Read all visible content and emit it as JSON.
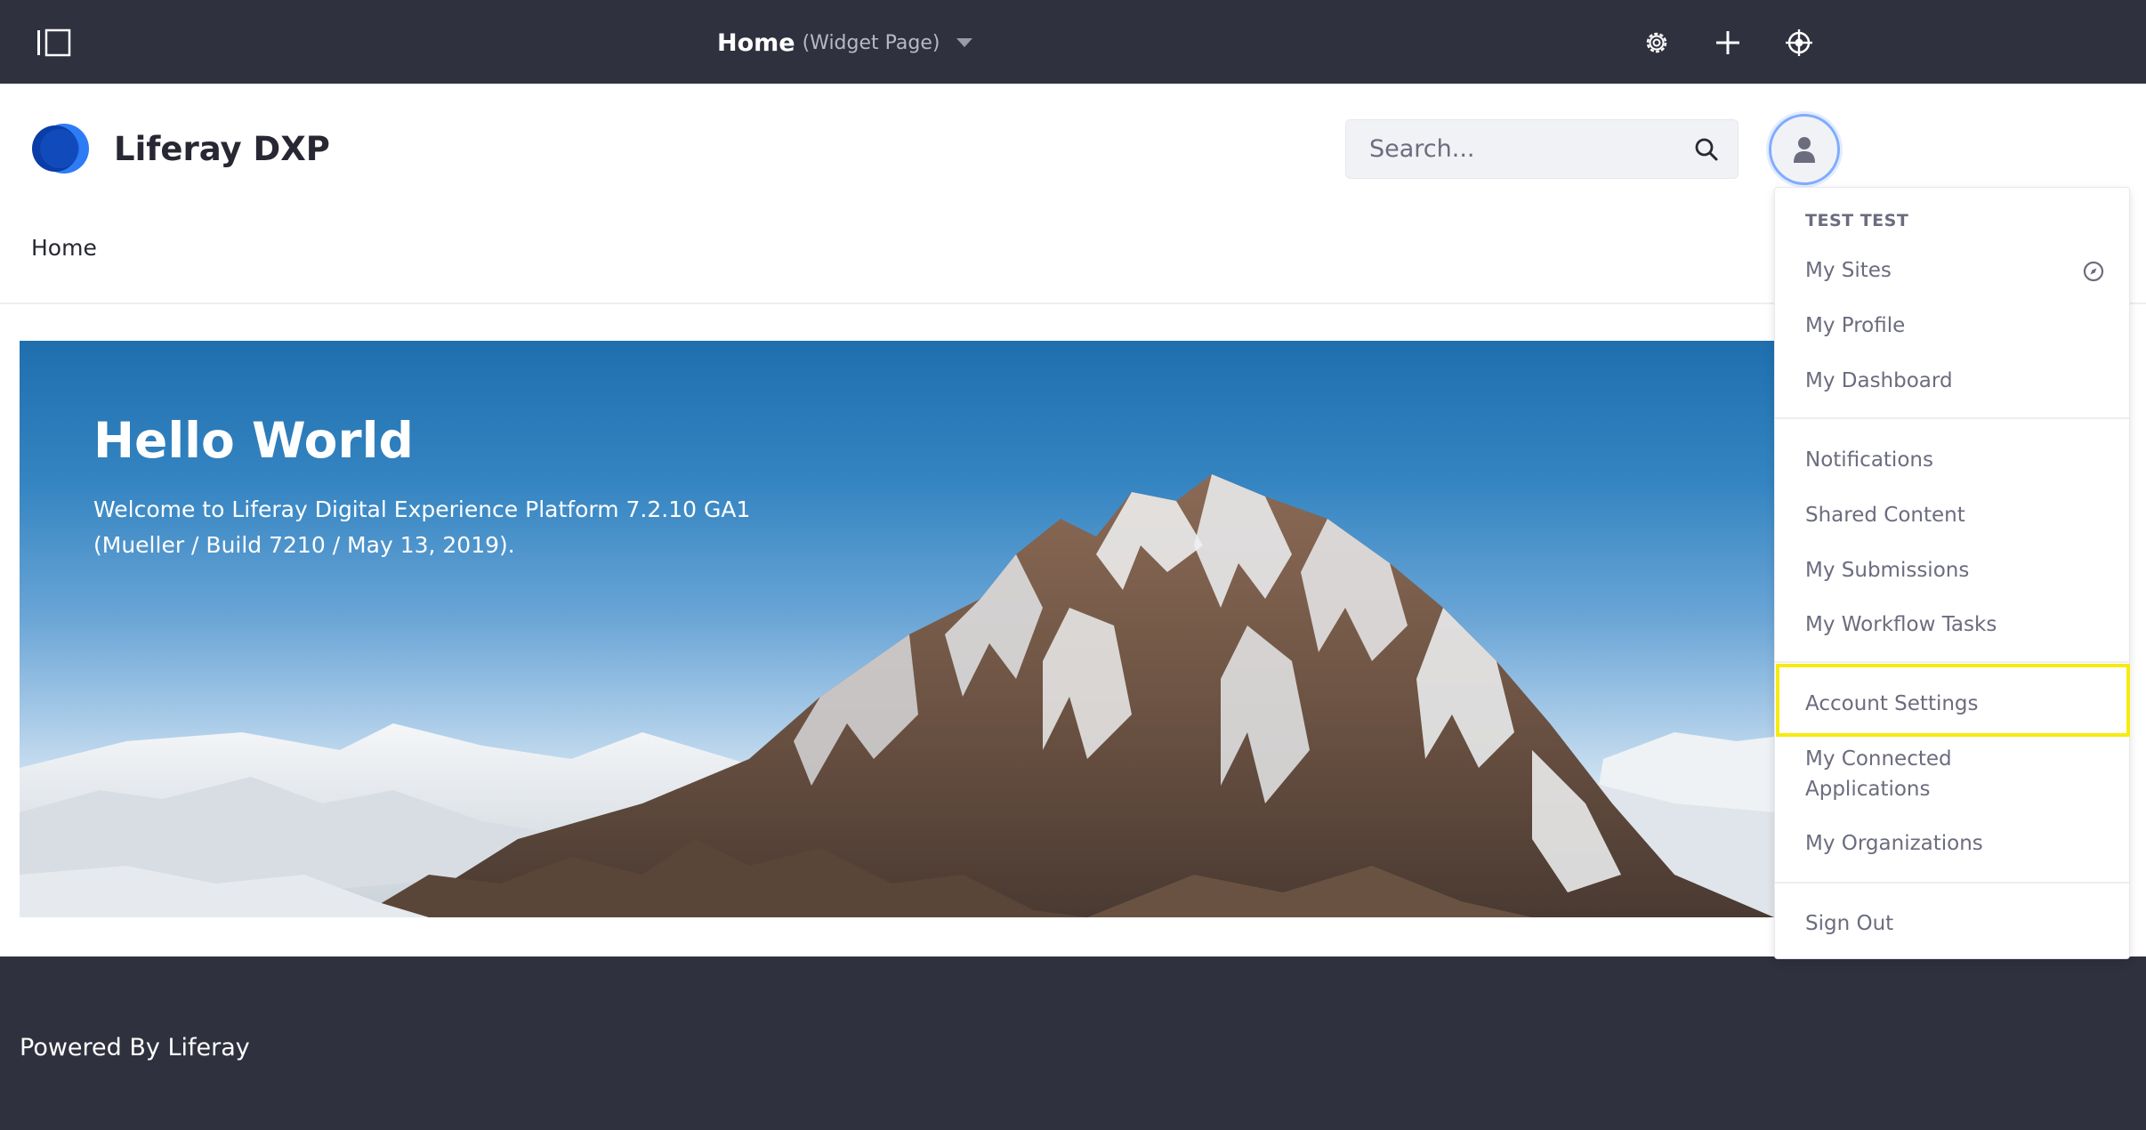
{
  "control_bar": {
    "page_title": "Home",
    "page_type": "(Widget Page)"
  },
  "header": {
    "site_name": "Liferay DXP",
    "search_placeholder": "Search..."
  },
  "nav": {
    "home_label": "Home"
  },
  "banner": {
    "title": "Hello World",
    "line1": "Welcome to Liferay Digital Experience Platform 7.2.10 GA1",
    "line2": "(Mueller / Build 7210 / May 13, 2019)."
  },
  "user_menu": {
    "user_name": "TEST TEST",
    "items": [
      {
        "label": "My Sites",
        "icon": "compass-icon"
      },
      {
        "label": "My Profile"
      },
      {
        "label": "My Dashboard"
      },
      {
        "label": "Notifications"
      },
      {
        "label": "Shared Content"
      },
      {
        "label": "My Submissions"
      },
      {
        "label": "My Workflow Tasks"
      },
      {
        "label": "Account Settings",
        "highlighted": true
      },
      {
        "label": "My Connected Applications"
      },
      {
        "label": "My Organizations"
      },
      {
        "label": "Sign Out"
      }
    ]
  },
  "footer": {
    "text": "Powered By Liferay"
  },
  "colors": {
    "control_bar": "#30313f",
    "highlight": "#f7ea10",
    "accent": "#0b5fff"
  }
}
